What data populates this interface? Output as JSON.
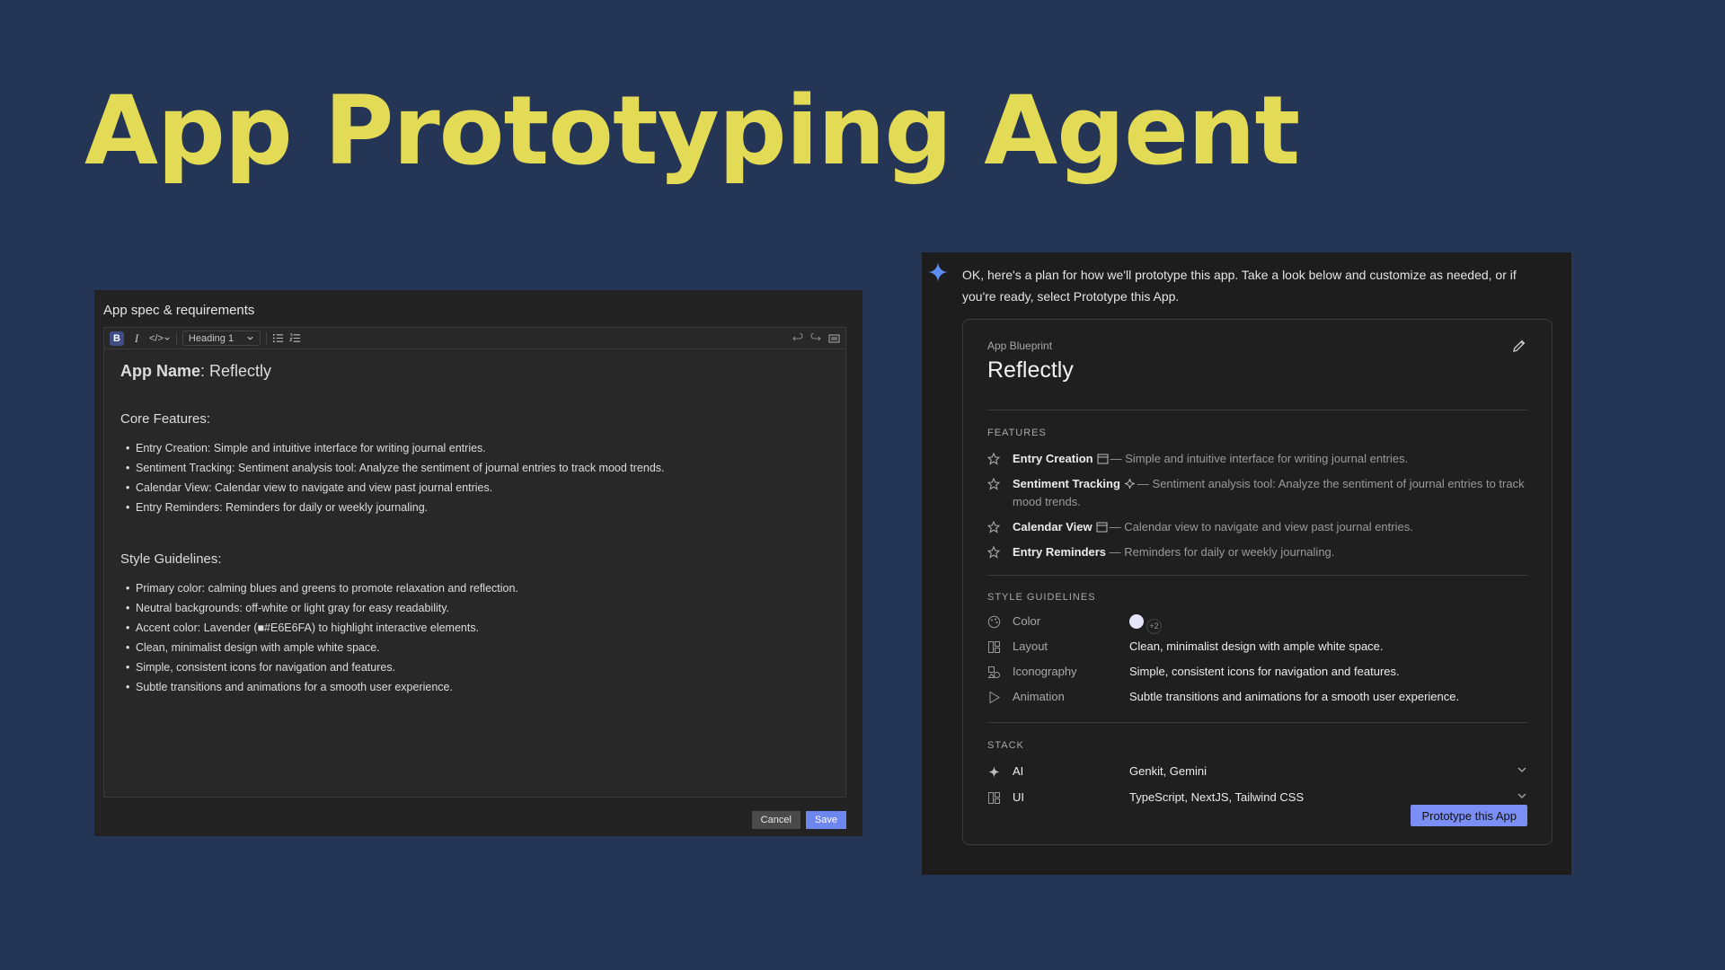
{
  "headline": "App Prototyping Agent",
  "editor": {
    "title": "App spec & requirements",
    "toolbar": {
      "bold": "B",
      "italic": "I",
      "code": "</>",
      "style_select": "Heading 1"
    },
    "app_name_label": "App Name",
    "app_name_value": ": Reflectly",
    "core_features_title": "Core Features:",
    "core_features": [
      "Entry Creation: Simple and intuitive interface for writing journal entries.",
      "Sentiment Tracking: Sentiment analysis tool: Analyze the sentiment of journal entries to track mood trends.",
      "Calendar View: Calendar view to navigate and view past journal entries.",
      "Entry Reminders: Reminders for daily or weekly journaling."
    ],
    "style_title": "Style Guidelines:",
    "style_items": [
      "Primary color: calming blues and greens to promote relaxation and reflection.",
      "Neutral backgrounds: off-white or light gray for easy readability.",
      "Accent color: Lavender (■#E6E6FA) to highlight interactive elements.",
      "Clean, minimalist design with ample white space.",
      "Simple, consistent icons for navigation and features.",
      "Subtle transitions and animations for a smooth user experience."
    ],
    "cancel_label": "Cancel",
    "save_label": "Save"
  },
  "chat": {
    "message": "OK, here's a plan for how we'll prototype this app. Take a look below and customize as needed, or if you're ready, select Prototype this App.",
    "blueprint": {
      "label": "App Blueprint",
      "name": "Reflectly",
      "features_heading": "FEATURES",
      "features": [
        {
          "name": "Entry Creation",
          "icon": "calendar-icon",
          "desc": "— Simple and intuitive interface for writing journal entries."
        },
        {
          "name": "Sentiment Tracking",
          "icon": "sparkle-icon",
          "desc": "— Sentiment analysis tool: Analyze the sentiment of journal entries to track mood trends."
        },
        {
          "name": "Calendar View",
          "icon": "calendar-icon",
          "desc": "— Calendar view to navigate and view past journal entries."
        },
        {
          "name": "Entry Reminders",
          "icon": "",
          "desc": "— Reminders for daily or weekly journaling."
        }
      ],
      "style_heading": "STYLE GUIDELINES",
      "style": [
        {
          "key": "Color",
          "icon": "palette-icon",
          "value": ""
        },
        {
          "key": "Layout",
          "icon": "layout-icon",
          "value": "Clean, minimalist design with ample white space."
        },
        {
          "key": "Iconography",
          "icon": "shapes-icon",
          "value": "Simple, consistent icons for navigation and features."
        },
        {
          "key": "Animation",
          "icon": "play-icon",
          "value": "Subtle transitions and animations for a smooth user experience."
        }
      ],
      "color_swatch": "#E6E6FA",
      "color_more": "+2",
      "stack_heading": "STACK",
      "stack": [
        {
          "key": "AI",
          "icon": "sparkle-icon",
          "value": "Genkit, Gemini"
        },
        {
          "key": "UI",
          "icon": "layout-icon",
          "value": "TypeScript, NextJS, Tailwind CSS"
        }
      ],
      "prototype_label": "Prototype this App"
    }
  },
  "colors": {
    "background": "#253555",
    "headline": "#E3DA55",
    "accent_button": "#7B8EF5",
    "save_button": "#6D86F0"
  }
}
